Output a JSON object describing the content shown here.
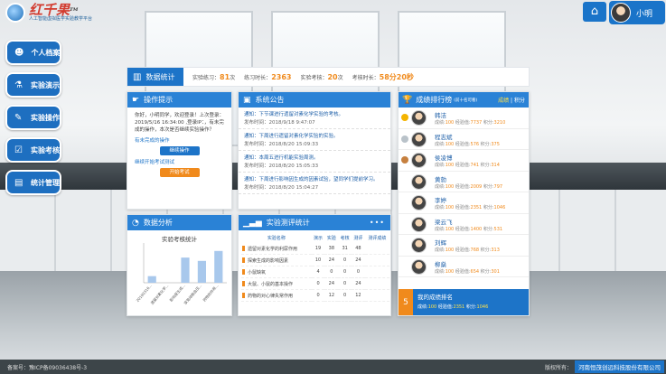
{
  "header": {
    "logo_title": "红千果",
    "logo_tm": "TM",
    "logo_subtitle": "人工智能虚拟医学实验教学平台",
    "user_name": "小明"
  },
  "menu": [
    {
      "label": "个人档案",
      "icon": "user-icon"
    },
    {
      "label": "实验演示",
      "icon": "pipette-icon"
    },
    {
      "label": "实验操作",
      "icon": "edit-icon"
    },
    {
      "label": "实验考核",
      "icon": "check-icon"
    },
    {
      "label": "统计管理",
      "icon": "stats-icon"
    }
  ],
  "stats": {
    "title": "数据统计",
    "items": [
      {
        "label": "实验练习：",
        "value": "81",
        "unit": "次"
      },
      {
        "label": "练习时长：",
        "value": "2363",
        "unit": ""
      },
      {
        "label": "实验考核：",
        "value": "20",
        "unit": "次"
      },
      {
        "label": "考核时长：",
        "value": "58分20秒",
        "unit": ""
      }
    ]
  },
  "tips": {
    "title": "操作提示",
    "greeting": "你好，小明同学，欢迎登录！上次登录：2019/5/16 16:34:00 ,登录IP：，有未完成的操作，本次是否继续实验操作？",
    "note1": "有未完成的操作",
    "btn1": "继续操作",
    "note2": "继续开始考试测试",
    "btn2": "开始考试"
  },
  "announcements": {
    "title": "系统公告",
    "items": [
      {
        "title": "通知：下节课进行遗留对素化学实验的考核。",
        "time": "发布时间：2018/9/18 9:47:07"
      },
      {
        "title": "通知：下周进行遗留对素化学实验的实验。",
        "time": "发布时间：2018/8/20 15:09:33"
      },
      {
        "title": "通知：本周五进行机能实验周测。",
        "time": "发布时间：2018/8/20 15:05:33"
      },
      {
        "title": "通知：下周进行影响因生成的因素试验，望同学们提前学习。",
        "time": "发布时间：2018/8/20 15:04:27"
      }
    ]
  },
  "ranking": {
    "title": "成绩排行榜",
    "subtitle": "(前十名可看)",
    "tab_active": "成绩",
    "tab_sep": " | ",
    "tab_other": "积分",
    "rows": [
      {
        "name": "韩洁",
        "score_label": "成绩:",
        "score": "100",
        "exp_label": "经验值:",
        "exp": "7737",
        "pts_label": "积分:",
        "pts": "3210",
        "medal": "#f4b400"
      },
      {
        "name": "程志斌",
        "score_label": "成绩:",
        "score": "100",
        "exp_label": "经验值:",
        "exp": "576",
        "pts_label": "积分:",
        "pts": "375",
        "medal": "#b9c2c9"
      },
      {
        "name": "侯凌博",
        "score_label": "成绩:",
        "score": "100",
        "exp_label": "经验值:",
        "exp": "741",
        "pts_label": "积分:",
        "pts": "314",
        "medal": "#c6803f"
      },
      {
        "name": "黄勍",
        "score_label": "成绩:",
        "score": "100",
        "exp_label": "经验值:",
        "exp": "2009",
        "pts_label": "积分:",
        "pts": "797",
        "medal": ""
      },
      {
        "name": "李婷",
        "score_label": "成绩:",
        "score": "100",
        "exp_label": "经验值:",
        "exp": "2351",
        "pts_label": "积分:",
        "pts": "1046",
        "medal": ""
      },
      {
        "name": "梁云飞",
        "score_label": "成绩:",
        "score": "100",
        "exp_label": "经验值:",
        "exp": "1400",
        "pts_label": "积分:",
        "pts": "531",
        "medal": ""
      },
      {
        "name": "刘辉",
        "score_label": "成绩:",
        "score": "100",
        "exp_label": "经验值:",
        "exp": "768",
        "pts_label": "积分:",
        "pts": "313",
        "medal": ""
      },
      {
        "name": "柳燊",
        "score_label": "成绩:",
        "score": "100",
        "exp_label": "经验值:",
        "exp": "654",
        "pts_label": "积分:",
        "pts": "301",
        "medal": ""
      }
    ],
    "mine": {
      "rank": "5",
      "title": "我的成绩排名",
      "score_label": "成绩:",
      "score": "100",
      "exp_label": "经验值:",
      "exp": "2351",
      "pts_label": "积分:",
      "pts": "1046"
    }
  },
  "analysis": {
    "title": "数据分析",
    "chart_title": "实验考核统计"
  },
  "chart_data": {
    "type": "bar",
    "title": "实验考核统计",
    "categories": [
      "20190316...",
      "遗留对素化学...",
      "影响尿生成...",
      "家兔动脉血压...",
      "药物的作用..."
    ],
    "values": [
      10,
      0,
      38,
      33,
      48
    ],
    "ylabel": "",
    "ylim": [
      0,
      60
    ],
    "color": "#a8c8ec"
  },
  "experiment": {
    "title": "实验测评统计",
    "more": "•••",
    "headers": [
      "实验名称",
      "演示",
      "实验",
      "考核",
      "测评",
      "测评成绩"
    ],
    "rows": [
      [
        "遗留对素化学的利尿作用",
        "19",
        "38",
        "31",
        "48",
        ""
      ],
      [
        "探索生成的影响因素",
        "10",
        "24",
        "0",
        "24",
        ""
      ],
      [
        "小鼠缺氧",
        "4",
        "0",
        "0",
        "0",
        ""
      ],
      [
        "大鼠、小鼠的基本操作",
        "0",
        "24",
        "0",
        "24",
        ""
      ],
      [
        "药物的对心律失常作用",
        "0",
        "12",
        "0",
        "12",
        ""
      ]
    ]
  },
  "footer": {
    "icp": "备案号：豫ICP备09036438号-3",
    "copyright_label": "版权所有：",
    "company": "河南恒茂创远科技股份有限公司"
  }
}
